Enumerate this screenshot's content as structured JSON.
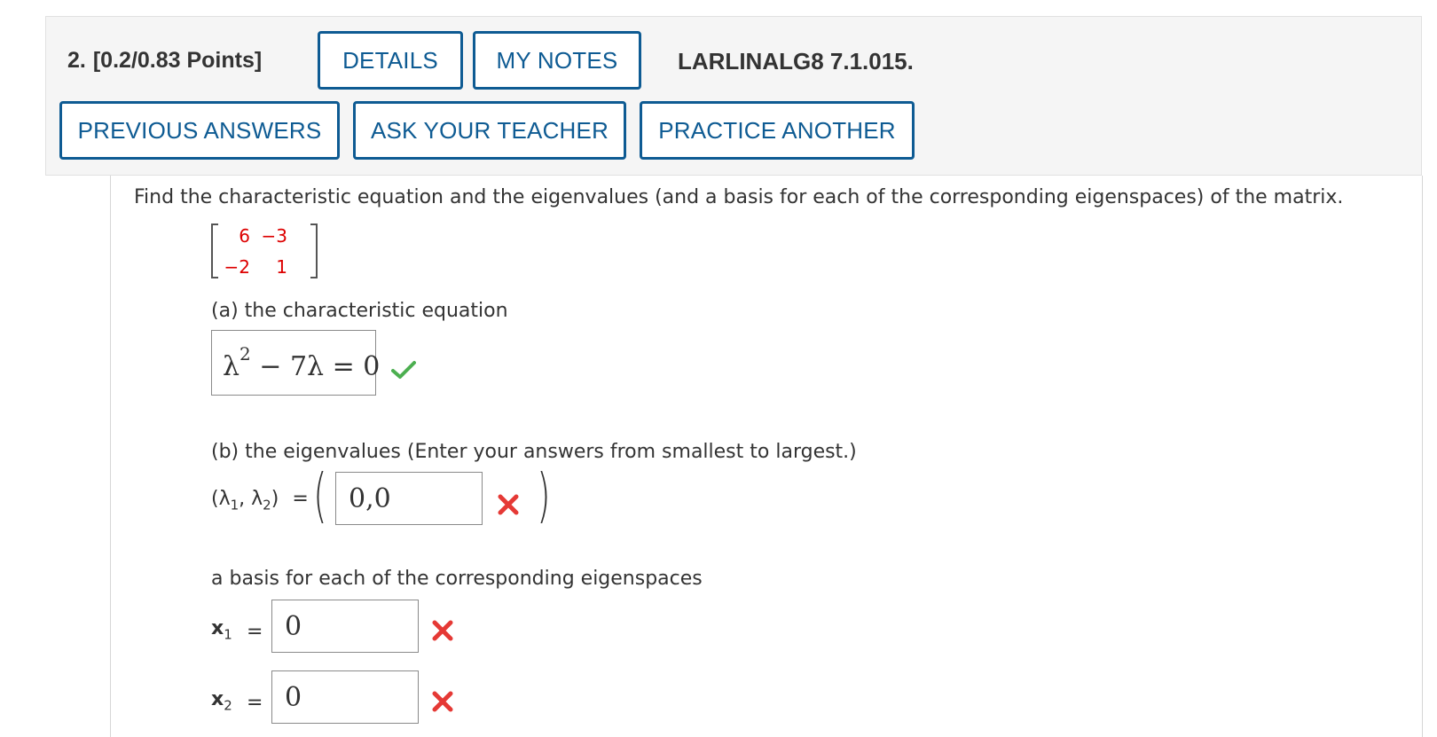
{
  "header": {
    "question_number": "2.",
    "points": "[0.2/0.83 Points]",
    "details_label": "DETAILS",
    "my_notes_label": "MY NOTES",
    "reference": "LARLINALG8 7.1.015.",
    "previous_answers_label": "PREVIOUS ANSWERS",
    "ask_teacher_label": "ASK YOUR TEACHER",
    "practice_another_label": "PRACTICE ANOTHER"
  },
  "problem": {
    "prompt": "Find the characteristic equation and the eigenvalues (and a basis for each of the corresponding eigenspaces) of the matrix.",
    "matrix": [
      [
        "6",
        "−3"
      ],
      [
        "−2",
        "1"
      ]
    ]
  },
  "part_a": {
    "label": "(a) the characteristic equation",
    "answer_base": "λ",
    "answer_exp": "2",
    "answer_rest": " − 7λ = 0",
    "status": "correct"
  },
  "part_b": {
    "label": "(b) the eigenvalues (Enter your answers from smallest to largest.)",
    "lambda_open": "(λ",
    "lambda_sub1": "1",
    "lambda_mid": ", λ",
    "lambda_sub2": "2",
    "lambda_close": ")",
    "equals": "=",
    "answer": "0,0",
    "status": "incorrect"
  },
  "basis": {
    "label": "a basis for each of the corresponding eigenspaces",
    "vectors": [
      {
        "name": "x",
        "sub": "1",
        "equals": "=",
        "answer": "0",
        "status": "incorrect"
      },
      {
        "name": "x",
        "sub": "2",
        "equals": "=",
        "answer": "0",
        "status": "incorrect"
      }
    ]
  },
  "colors": {
    "accent": "#0e5b93",
    "matrix_entry": "#dd0000",
    "correct": "#4caf50",
    "incorrect": "#e53935"
  }
}
